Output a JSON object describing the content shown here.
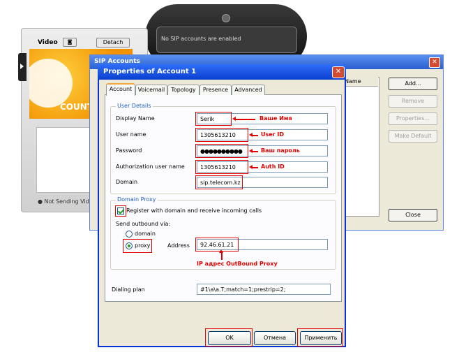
{
  "phone": {
    "status_text": "No SIP accounts are enabled"
  },
  "video": {
    "title": "Video",
    "detach_label": "Detach",
    "image_text": "COUNT",
    "status": "Not Sending Vide"
  },
  "sip_window": {
    "title": "SIP Accounts",
    "column_name": "Name",
    "buttons": {
      "add": "Add...",
      "remove": "Remove",
      "properties": "Properties...",
      "make_default": "Make Default",
      "close": "Close"
    }
  },
  "dialog": {
    "title": "Properties of Account 1",
    "tabs": [
      "Account",
      "Voicemail",
      "Topology",
      "Presence",
      "Advanced"
    ],
    "user_details": {
      "legend": "User Details",
      "display_name_label": "Display Name",
      "display_name_value": "Serik",
      "user_name_label": "User name",
      "user_name_value": "1305613210",
      "password_label": "Password",
      "password_value": "●●●●●●●●●●",
      "auth_user_label": "Authorization user name",
      "auth_user_value": "1305613210",
      "domain_label": "Domain",
      "domain_value": "sip.telecom.kz"
    },
    "domain_proxy": {
      "legend": "Domain Proxy",
      "register_label": "Register with domain and receive incoming calls",
      "send_outbound_label": "Send outbound via:",
      "radio_domain": "domain",
      "radio_proxy": "proxy",
      "address_label": "Address",
      "address_value": "92.46.61.21"
    },
    "dialing_plan_label": "Dialing plan",
    "dialing_plan_value": "#1\\a\\a.T;match=1;prestrip=2;",
    "buttons": {
      "ok": "OK",
      "cancel": "Отмена",
      "apply": "Применить"
    }
  },
  "annotations": {
    "name": "Ваше Имя",
    "user_id": "User ID",
    "password": "Ваш пароль",
    "auth_id": "Auth ID",
    "proxy": "IP адрес OutBound Proxy"
  },
  "colors": {
    "annotation_red": "#e00000",
    "title_blue": "#0a3fd0",
    "legend_blue": "#1d5bbd"
  }
}
